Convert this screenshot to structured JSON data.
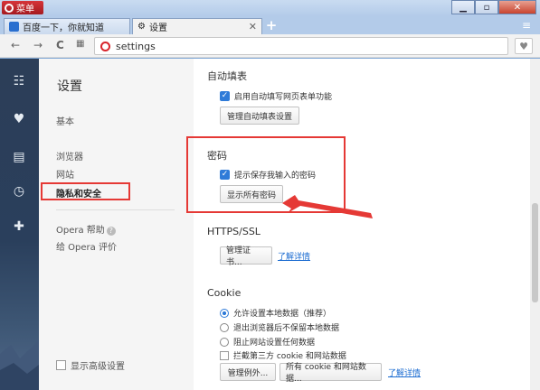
{
  "browser": {
    "menu_label": "菜单",
    "tabs": [
      {
        "title": "百度一下，你就知道"
      },
      {
        "title": "设置"
      }
    ],
    "new_tab": "+",
    "address": "settings"
  },
  "settings_nav": {
    "title": "设置",
    "items": [
      {
        "label": "基本"
      },
      {
        "label": "浏览器"
      },
      {
        "label": "网站"
      },
      {
        "label": "隐私和安全"
      }
    ],
    "help": "Opera 帮助",
    "rate": "给 Opera 评价",
    "advanced": "显示高级设置"
  },
  "main": {
    "autofill": {
      "title": "自动填表",
      "checkbox": "启用自动填写网页表单功能",
      "button": "管理自动填表设置"
    },
    "password": {
      "title": "密码",
      "checkbox": "提示保存我输入的密码",
      "button": "显示所有密码"
    },
    "https": {
      "title": "HTTPS/SSL",
      "button": "管理证书...",
      "link": "了解详情"
    },
    "cookie": {
      "title": "Cookie",
      "options": [
        "允许设置本地数据（推荐）",
        "退出浏览器后不保留本地数据",
        "阻止网站设置任何数据"
      ],
      "block_third_party": "拦截第三方 cookie 和网站数据",
      "btn_exceptions": "管理例外...",
      "btn_all": "所有 cookie 和网站数据...",
      "link": "了解详情"
    }
  },
  "colors": {
    "highlight": "#e53935",
    "accent": "#2f7bd8",
    "opera_red": "#d8242b"
  }
}
